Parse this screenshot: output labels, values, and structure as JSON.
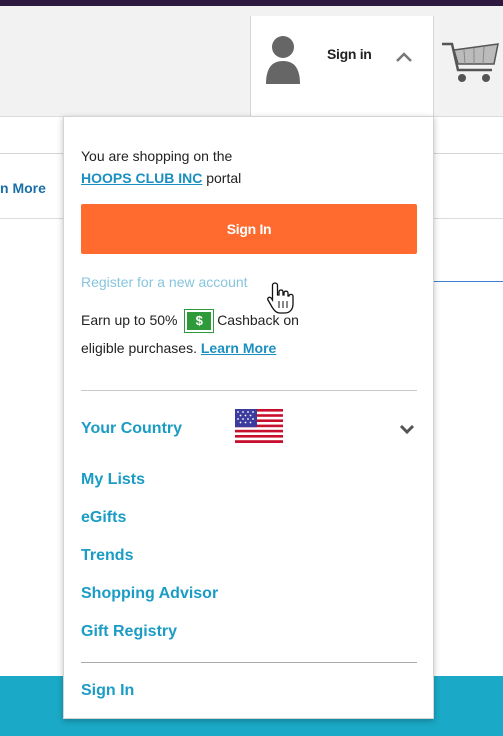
{
  "header": {
    "signin_label": "Sign in"
  },
  "background": {
    "learn_more_partial": "n More"
  },
  "dropdown": {
    "shopping_prefix": "You are shopping on the",
    "portal_name": "HOOPS CLUB INC",
    "portal_suffix": " portal",
    "signin_button": "Sign In",
    "register_link": "Register for a new account",
    "earn_prefix": "Earn up to 50%",
    "cash_symbol": "$",
    "earn_suffix": "Cashback on",
    "eligible_text": "eligible purchases.",
    "learn_more": "Learn More",
    "country_label": "Your Country",
    "menu_items": [
      "My Lists",
      "eGifts",
      "Trends",
      "Shopping Advisor",
      "Gift Registry"
    ],
    "signin_bottom": "Sign In"
  },
  "colors": {
    "accent_orange": "#ff6b2e",
    "link_blue": "#1a9cc5",
    "teal_footer": "#1aa9c6"
  },
  "icons": [
    "user-icon",
    "caret-up-icon",
    "cart-icon",
    "cursor-hand-icon",
    "cash-icon",
    "us-flag-icon",
    "chevron-down-icon"
  ]
}
